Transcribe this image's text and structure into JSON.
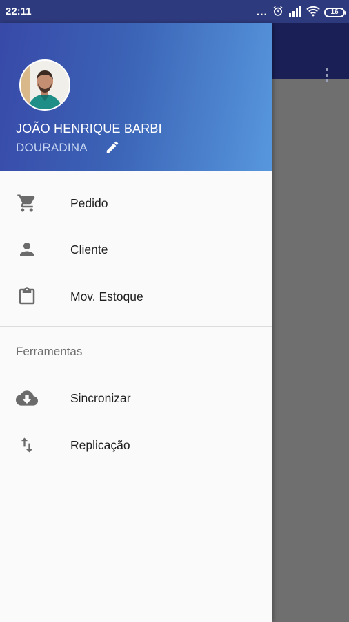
{
  "status_bar": {
    "time": "22:11",
    "dots": "...",
    "battery": "16",
    "icons": [
      "alarm-icon",
      "signal-icon",
      "wifi-icon",
      "battery-icon"
    ]
  },
  "app_bar": {
    "menu_icon": "more-vert-icon"
  },
  "drawer": {
    "header": {
      "user_name": "JOÃO HENRIQUE BARBI",
      "city": "DOURADINA",
      "edit_icon": "pencil-icon"
    },
    "items": [
      {
        "label": "Pedido",
        "icon": "cart-icon"
      },
      {
        "label": "Cliente",
        "icon": "person-icon"
      },
      {
        "label": "Mov. Estoque",
        "icon": "clipboard-icon"
      }
    ],
    "section_title": "Ferramentas",
    "tools": [
      {
        "label": "Sincronizar",
        "icon": "cloud-download-icon"
      },
      {
        "label": "Replicação",
        "icon": "swap-vertical-icon"
      }
    ]
  },
  "colors": {
    "header_start": "#3849a8",
    "header_end": "#5797dd",
    "toolbar": "#1a1f56",
    "scrim": "#6f6f6f"
  }
}
